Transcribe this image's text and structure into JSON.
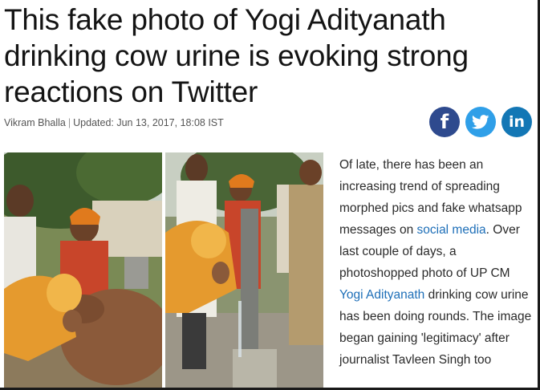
{
  "headline": "This fake photo of Yogi Adityanath drinking cow urine is evoking strong reactions on Twitter",
  "byline": {
    "author": "Vikram Bhalla",
    "separator": "|",
    "updated": "Updated: Jun 13, 2017, 18:08 IST"
  },
  "share": {
    "facebook_glyph": "f",
    "linkedin_glyph": "in",
    "icons": [
      "facebook-icon",
      "twitter-icon",
      "linkedin-icon"
    ],
    "colors": {
      "facebook": "#2e4a8e",
      "twitter": "#2f9fe8",
      "linkedin": "#1377b5"
    }
  },
  "article": {
    "part1": "Of late, there has been an increasing trend of spreading morphed pics and fake whatsapp messages on ",
    "link1": "social media",
    "part2": ". Over last couple of days, a photoshopped photo of UP CM ",
    "link2": "Yogi Adityanath",
    "part3": " drinking cow urine has been doing rounds. The image began gaining 'legitimacy' after journalist Tavleen Singh too",
    "link_color": "#1e6fb8"
  }
}
